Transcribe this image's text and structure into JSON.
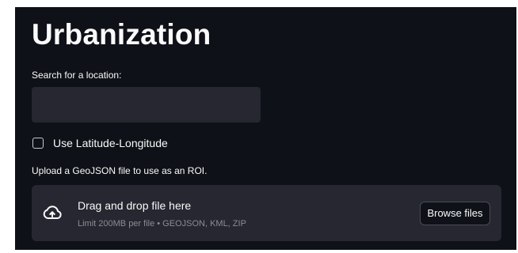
{
  "page": {
    "title": "Urbanization"
  },
  "search": {
    "label": "Search for a location:",
    "value": "",
    "placeholder": ""
  },
  "latlon": {
    "label": "Use Latitude-Longitude",
    "checked": false
  },
  "upload": {
    "label": "Upload a GeoJSON file to use as an ROI.",
    "drop_title": "Drag and drop file here",
    "drop_hint": "Limit 200MB per file • GEOJSON, KML, ZIP",
    "browse_label": "Browse files",
    "icon": "cloud-upload-icon"
  },
  "colors": {
    "background": "#0e1117",
    "surface": "#262730",
    "text": "#fafafa",
    "muted_text": "#8b8d96"
  }
}
